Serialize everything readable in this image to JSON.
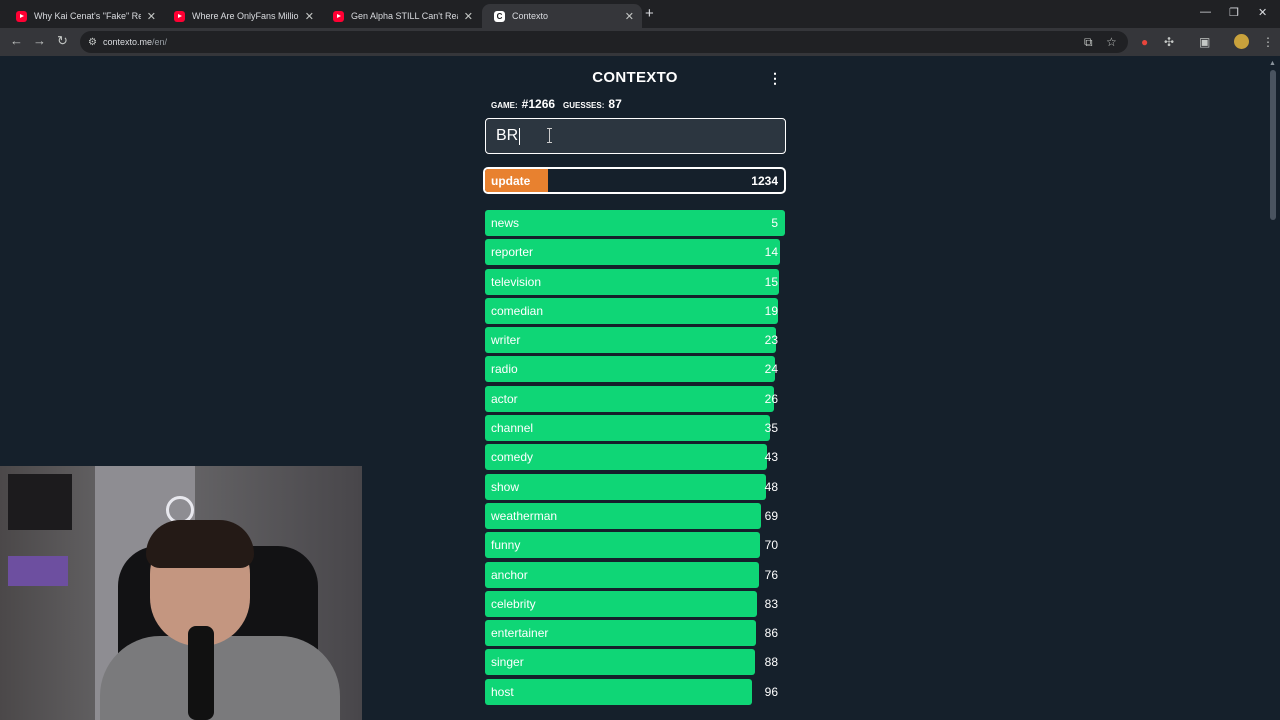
{
  "browser": {
    "tabs": [
      {
        "title": "Why Kai Cenat's \"Fake\" Rebrand",
        "favicon": "youtube-icon",
        "active": false
      },
      {
        "title": "Where Are OnlyFans Millionaires",
        "favicon": "youtube-icon",
        "active": false
      },
      {
        "title": "Gen Alpha STILL Can't Read and",
        "favicon": "youtube-icon",
        "active": false
      },
      {
        "title": "Contexto",
        "favicon": "contexto-icon",
        "active": true
      }
    ],
    "url_host": "contexto.me",
    "url_path": "/en/"
  },
  "game": {
    "title": "CONTEXTO",
    "game_label": "GAME:",
    "game_number": "#1266",
    "guesses_label": "GUESSES:",
    "guesses_count": "87",
    "input_value": "BR",
    "current_guess": {
      "word": "update",
      "rank": "1234",
      "fill_fraction": 0.21
    },
    "guesses": [
      {
        "word": "news",
        "rank": "5",
        "fill": 1.0
      },
      {
        "word": "reporter",
        "rank": "14",
        "fill": 0.983
      },
      {
        "word": "television",
        "rank": "15",
        "fill": 0.98
      },
      {
        "word": "comedian",
        "rank": "19",
        "fill": 0.977
      },
      {
        "word": "writer",
        "rank": "23",
        "fill": 0.97
      },
      {
        "word": "radio",
        "rank": "24",
        "fill": 0.967
      },
      {
        "word": "actor",
        "rank": "26",
        "fill": 0.963
      },
      {
        "word": "channel",
        "rank": "35",
        "fill": 0.95
      },
      {
        "word": "comedy",
        "rank": "43",
        "fill": 0.94
      },
      {
        "word": "show",
        "rank": "48",
        "fill": 0.937
      },
      {
        "word": "weatherman",
        "rank": "69",
        "fill": 0.92
      },
      {
        "word": "funny",
        "rank": "70",
        "fill": 0.917
      },
      {
        "word": "anchor",
        "rank": "76",
        "fill": 0.913
      },
      {
        "word": "celebrity",
        "rank": "83",
        "fill": 0.907
      },
      {
        "word": "entertainer",
        "rank": "86",
        "fill": 0.903
      },
      {
        "word": "singer",
        "rank": "88",
        "fill": 0.9
      },
      {
        "word": "host",
        "rank": "96",
        "fill": 0.89
      }
    ]
  },
  "colors": {
    "close": "#0fd676",
    "far": "#e8812f",
    "background": "#15202b"
  }
}
